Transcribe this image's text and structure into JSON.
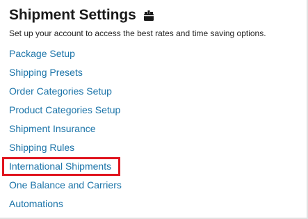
{
  "header": {
    "title": "Shipment Settings",
    "icon": "box-icon",
    "subtitle": "Set up your account to access the best rates and time saving options."
  },
  "settings_links": [
    {
      "label": "Package Setup"
    },
    {
      "label": "Shipping Presets"
    },
    {
      "label": "Order Categories Setup"
    },
    {
      "label": "Product Categories Setup"
    },
    {
      "label": "Shipment Insurance"
    },
    {
      "label": "Shipping Rules"
    },
    {
      "label": "International Shipments",
      "highlighted": true
    },
    {
      "label": "One Balance and Carriers"
    },
    {
      "label": "Automations"
    }
  ],
  "colors": {
    "link": "#1a73a8",
    "title": "#1a1a1a",
    "highlight_border": "#e0141e"
  }
}
